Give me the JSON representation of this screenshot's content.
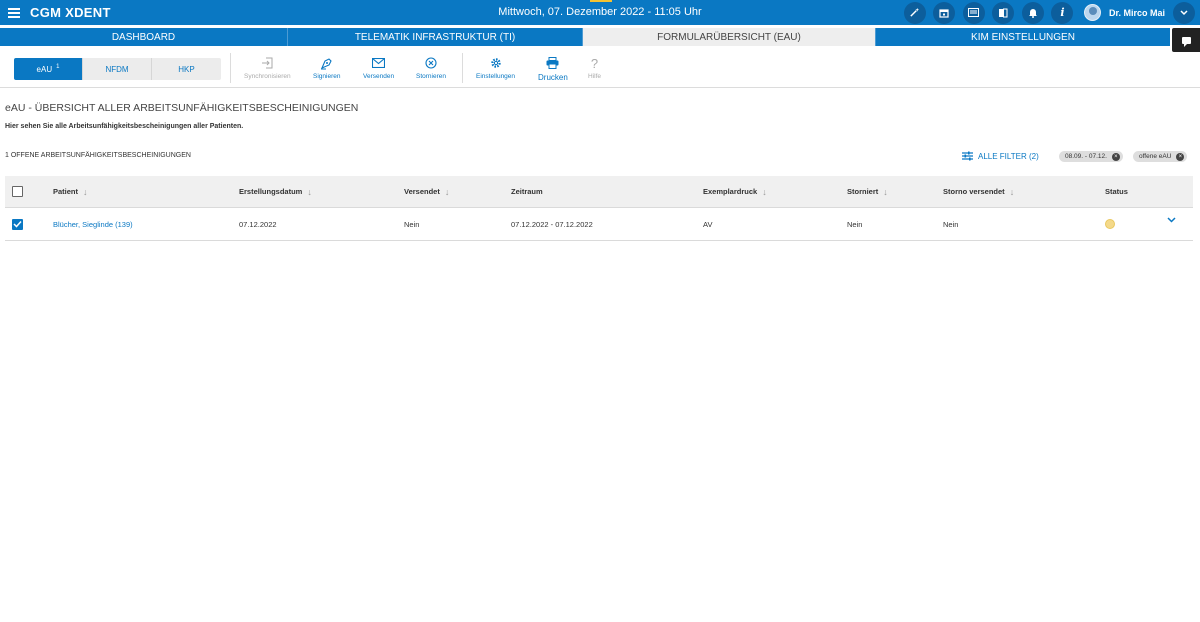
{
  "header": {
    "app_title": "CGM XDENT",
    "datetime": "Mittwoch, 07. Dezember 2022 - 11:05 Uhr",
    "user_name": "Dr. Mirco Mai"
  },
  "nav": {
    "tabs": [
      {
        "label": "DASHBOARD"
      },
      {
        "label": "TELEMATIK INFRASTRUKTUR (TI)"
      },
      {
        "label": "FORMULARÜBERSICHT (EAU)"
      },
      {
        "label": "KIM EINSTELLUNGEN"
      }
    ]
  },
  "toolbar": {
    "segments": [
      {
        "label": "eAU",
        "badge": "1"
      },
      {
        "label": "NFDM"
      },
      {
        "label": "HKP"
      }
    ],
    "buttons": {
      "sync": "Synchronisieren",
      "sign": "Signieren",
      "send": "Versenden",
      "cancel": "Stornieren",
      "settings": "Einstellungen",
      "print": "Drucken",
      "help": "Hilfe"
    }
  },
  "content": {
    "title": "eAU - ÜBERSICHT ALLER ARBEITSUNFÄHIGKEITSBESCHEINIGUNGEN",
    "subtitle": "Hier sehen Sie alle Arbeitsunfähigkeitsbescheinigungen aller Patienten.",
    "count_label": "1 OFFENE ARBEITSUNFÄHIGKEITSBESCHEINIGUNGEN",
    "filter_label": "ALLE FILTER (2)",
    "chips": [
      "08.09. - 07.12.",
      "offene eAU"
    ]
  },
  "table": {
    "columns": {
      "patient": "Patient",
      "created": "Erstellungsdatum",
      "sent": "Versendet",
      "period": "Zeitraum",
      "copy": "Exemplardruck",
      "cancelled": "Storniert",
      "cancel_sent": "Storno versendet",
      "status": "Status"
    },
    "rows": [
      {
        "patient": "Blücher, Sieglinde (139)",
        "created": "07.12.2022",
        "sent": "Nein",
        "period": "07.12.2022 - 07.12.2022",
        "copy": "AV",
        "cancelled": "Nein",
        "cancel_sent": "Nein",
        "status_color": "#f4d98a",
        "checked": true
      }
    ]
  },
  "colors": {
    "brand": "#0a78c3",
    "brand_dark": "#0c5e9c",
    "status_pending": "#f4d98a"
  }
}
